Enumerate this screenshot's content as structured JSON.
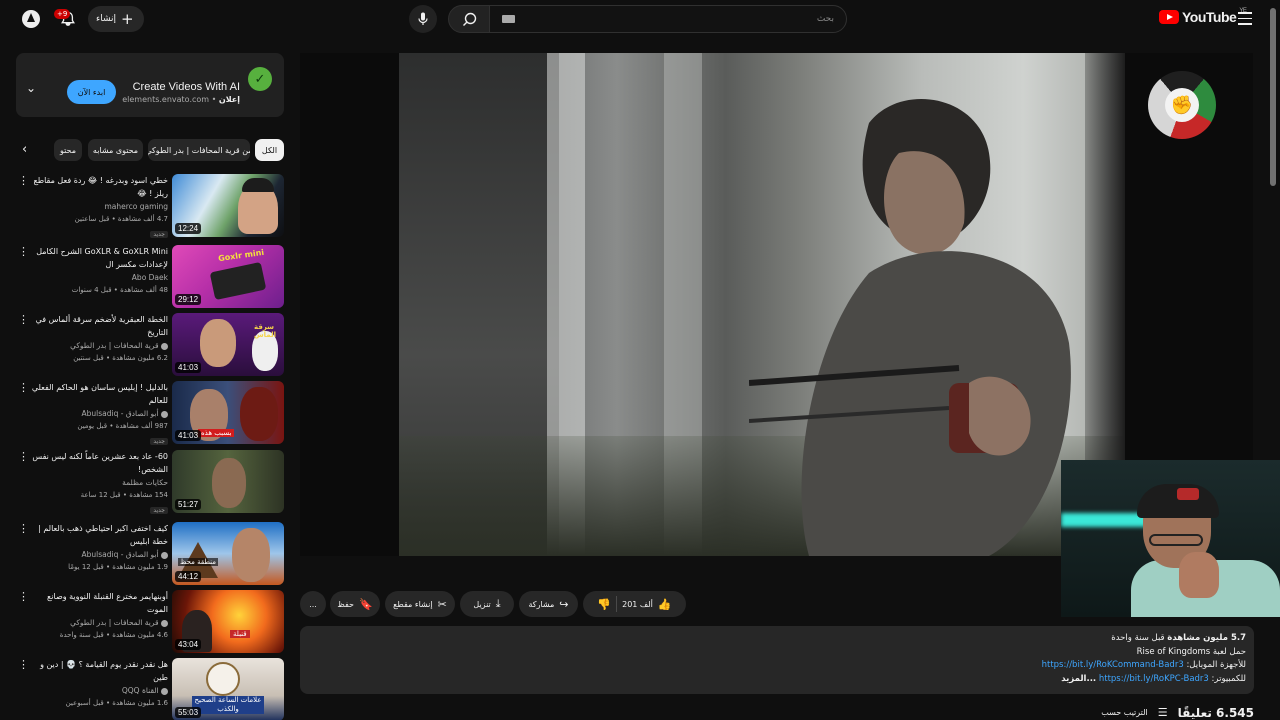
{
  "header": {
    "logo_text": "YouTube",
    "logo_region": "YE",
    "search_placeholder": "بحث",
    "create_label": "إنشاء",
    "notifications_badge": "+9"
  },
  "ad": {
    "title": "Create Videos With AI",
    "domain": "elements.envato.com",
    "sponsored": "إعلان",
    "cta": "ابدء الآن"
  },
  "chips": [
    "الكل",
    "من قرية المحافات | بدر الطوكي",
    "محتوى مشابه",
    "محتو"
  ],
  "recommendations": [
    {
      "title": "خطي اسود وبدرغه ! 😂 ردة فعل مقاطع ريلز ! 😂",
      "channel": "maherco gaming",
      "meta": "4.7 ألف مشاهدة • قبل ساعتين",
      "badge": "جديد",
      "duration": "12:24"
    },
    {
      "title": "GoXLR & GoXLR Mini الشرح الكامل لإعدادات مكسر ال",
      "channel": "Abo Daek",
      "meta": "48 ألف مشاهدة • قبل 4 سنوات",
      "badge": "",
      "duration": "29:12"
    },
    {
      "title": "الخطة العبقرية لأضخم سرقة ألماس في التاريخ",
      "channel": "قرية المحافات | بدر الطوكي",
      "meta": "6.2 مليون مشاهدة • قبل سنتين",
      "badge": "",
      "duration": "41:03"
    },
    {
      "title": "بالدليل ! إبليس ساسان هو الحاكم الفعلي للعالم",
      "channel": "أبو الصادق - Abulsadiq",
      "meta": "987 ألف مشاهدة • قبل يومين",
      "badge": "جديد",
      "duration": "41:03"
    },
    {
      "title": "60- عاد بعد عشرين عاماً لكنه ليس نفس الشخص!",
      "channel": "حكايات مظلمة",
      "meta": "154 مشاهدة • قبل 12 ساعة",
      "badge": "جديد",
      "duration": "51:27"
    },
    {
      "title": "كيف اختفى اكبر احتياطي ذهب بالعالم | خطة ابليس",
      "channel": "أبو الصادق - Abulsadiq",
      "meta": "1.9 مليون مشاهدة • قبل 12 يومًا",
      "badge": "",
      "duration": "44:12"
    },
    {
      "title": "أوبنهايمر مخترع القنبلة النووية وصانع الموت",
      "channel": "قرية المحافات | بدر الطوكي",
      "meta": "4.6 مليون مشاهدة • قبل سنة واحدة",
      "badge": "",
      "duration": "43:04"
    },
    {
      "title": "هل نقدر نقدر يوم القيامة ؟ 💀 | دين و طين",
      "channel": "القناة QQQ",
      "meta": "1.6 مليون مشاهدة • قبل أسبوعين",
      "badge": "",
      "duration": "55:03"
    }
  ],
  "thumb_captions": [
    "Goxlr mini",
    "سرقة الماس",
    "بسبب هذه",
    "",
    "منطقة محظ",
    "قنبلة",
    "علامات الساعة الصحيح والكذب"
  ],
  "actions": {
    "likes": "201 ألف",
    "share": "مشاركة",
    "download": "تنزيل",
    "clip": "إنشاء مقطع",
    "save": "حفظ",
    "more": "..."
  },
  "description": {
    "views": "5.7 مليون مشاهدة",
    "date": "قبل سنة واحدة",
    "line2": "حمل لعبة Rise of Kingdoms",
    "line3_prefix": "للأجهزة الموبايل:",
    "link1": "https://bit.ly/RoKCommand-Badr3",
    "line4_prefix": "للكمبيوتر:",
    "link2": "https://bit.ly/RoKPC-Badr3",
    "more": "...المزيد"
  },
  "comments": {
    "count": "6.545 تعليقًا",
    "sort": "الترتيب حسب"
  },
  "colors": {
    "background": "#0f0f0f",
    "surface": "#272727",
    "accent_link": "#3ea6ff",
    "brand_red": "#ff0000"
  }
}
